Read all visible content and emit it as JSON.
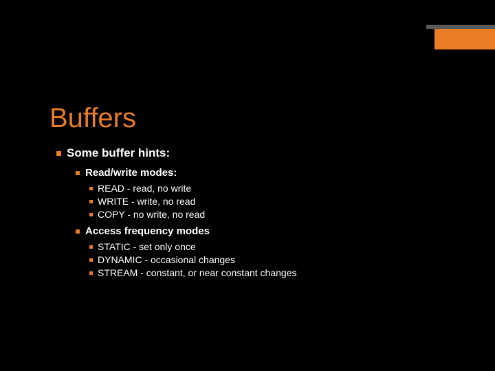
{
  "accent": "#e97c24",
  "title": "Buffers",
  "lvl1": "Some buffer hints:",
  "sections": [
    {
      "heading": "Read/write modes:",
      "items": [
        "READ - read, no write",
        "WRITE - write, no read",
        "COPY -  no write, no read"
      ]
    },
    {
      "heading": "Access frequency modes",
      "items": [
        "STATIC - set only once",
        "DYNAMIC - occasional changes",
        "STREAM - constant, or near constant changes"
      ]
    }
  ]
}
